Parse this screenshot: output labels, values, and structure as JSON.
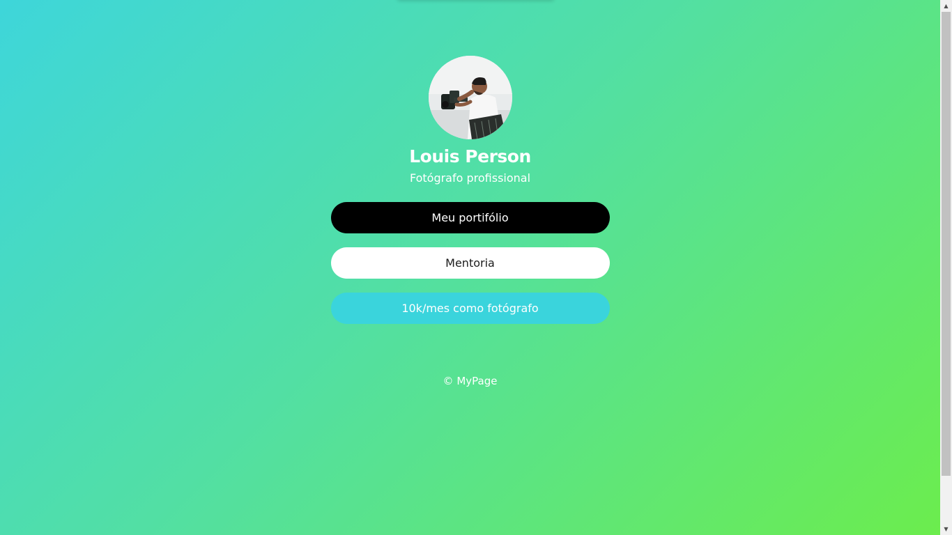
{
  "profile": {
    "name": "Louis Person",
    "subtitle": "Fotógrafo profissional",
    "avatar_alt": "Photographer holding a camera rig"
  },
  "links": [
    {
      "label": "Meu portifólio",
      "style": "black"
    },
    {
      "label": "Mentoria",
      "style": "white"
    },
    {
      "label": "10k/mes como fotógrafo",
      "style": "cyan"
    }
  ],
  "footer": {
    "text": "© MyPage"
  },
  "colors": {
    "gradient_start": "#3ed6da",
    "gradient_end": "#6ced4c",
    "button_black": "#000000",
    "button_white": "#ffffff",
    "button_cyan": "#3ad4dc"
  },
  "scrollbar": {
    "up_icon": "chevron-up-icon",
    "down_icon": "chevron-down-icon"
  }
}
